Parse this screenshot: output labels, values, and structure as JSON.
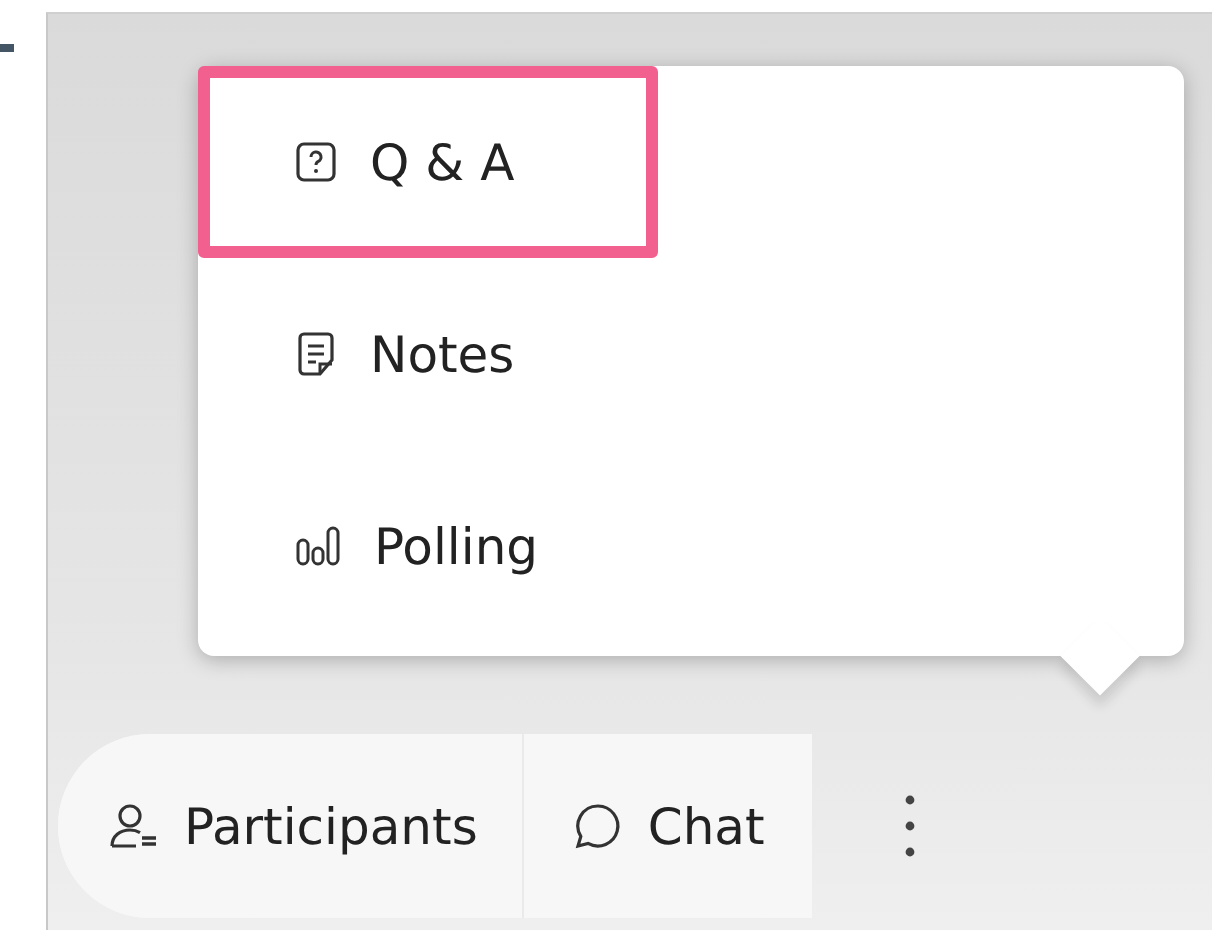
{
  "menu": {
    "items": [
      {
        "kind": "qa",
        "label": "Q & A",
        "highlighted": true
      },
      {
        "kind": "notes",
        "label": "Notes",
        "highlighted": false
      },
      {
        "kind": "polling",
        "label": "Polling",
        "highlighted": false
      }
    ]
  },
  "toolbar": {
    "buttons": [
      {
        "kind": "participants",
        "label": "Participants"
      },
      {
        "kind": "chat",
        "label": "Chat"
      }
    ]
  }
}
